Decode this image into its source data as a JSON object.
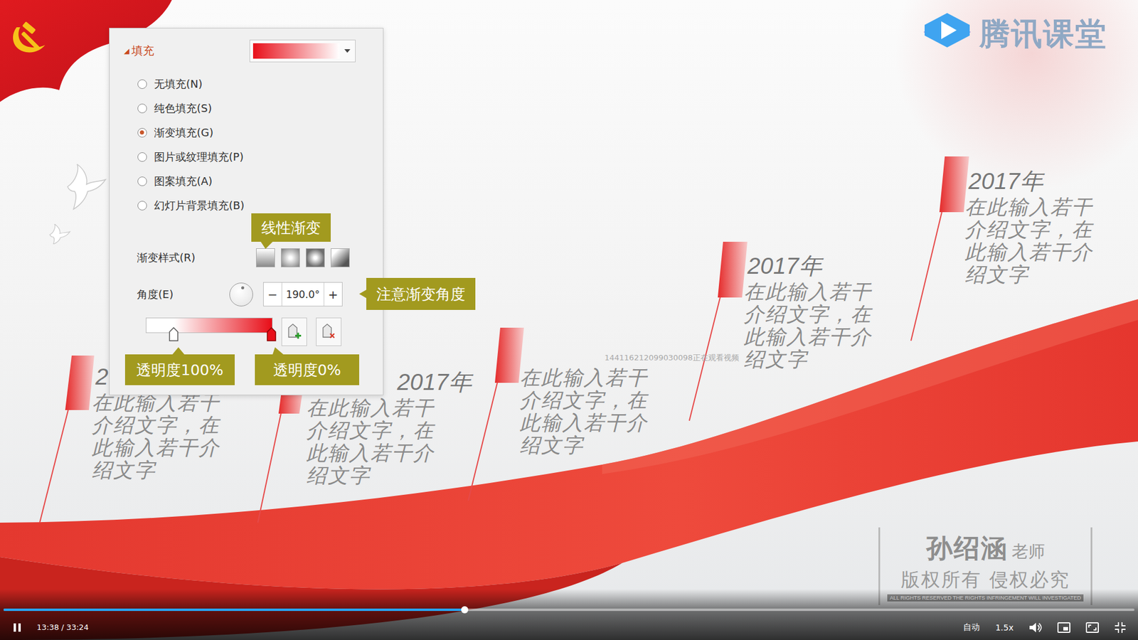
{
  "player": {
    "brand": "腾讯课堂",
    "watermark": "144116212099030098正在观看视频",
    "time": "13:38 / 33:24",
    "progress": 0.408,
    "playing": true,
    "quality": "自动",
    "speed": "1.5x"
  },
  "copyright": {
    "name": "孙绍涵",
    "title": "老师",
    "notice": "版权所有 侵权必究",
    "fine": "ALL RIGHTS RESERVED THE RIGHTS INFRINGEMENT WILL INVESTIGATED"
  },
  "fill_panel": {
    "toggle": "◢",
    "section": "填充",
    "expanded": true,
    "options": [
      {
        "label": "无填充(N)",
        "selected": false
      },
      {
        "label": "纯色填充(S)",
        "selected": false
      },
      {
        "label": "渐变填充(G)",
        "selected": true
      },
      {
        "label": "图片或纹理填充(P)",
        "selected": false
      },
      {
        "label": "图案填充(A)",
        "selected": false
      },
      {
        "label": "幻灯片背景填充(B)",
        "selected": false
      }
    ],
    "gradient_style": {
      "label": "渐变样式(R)",
      "styles": [
        {
          "kind": "linear"
        },
        {
          "kind": "radial"
        },
        {
          "kind": "rectangular"
        },
        {
          "kind": "path"
        }
      ]
    },
    "angle": {
      "label": "角度(E)",
      "value": "190.0°",
      "minus": "−",
      "plus": "+"
    },
    "stops": [
      {
        "level": 0.22,
        "color": "#ffffff",
        "selected": false
      },
      {
        "level": 0.99,
        "color": "#e8101a",
        "selected": true
      }
    ]
  },
  "callouts": [
    {
      "text": "线性渐变"
    },
    {
      "text": "注意渐变角度"
    },
    {
      "text": "透明度100%"
    },
    {
      "text": "透明度0%"
    }
  ],
  "timeline": [
    {
      "year": "2",
      "text": "在此输入若干介绍文字，在此输入若干介绍文字"
    },
    {
      "year": "2017年",
      "text": "在此输入若干介绍文字，在此输入若干介绍文字"
    },
    {
      "text": "在此输入若干介绍文字，在此输入若干介绍文字"
    },
    {
      "year": "2017年",
      "text": "在此输入若干介绍文字，在此输入若干介绍文字"
    },
    {
      "year": "2017年",
      "text": "在此输入若干介绍文字，在此输入若干介绍文字"
    }
  ]
}
